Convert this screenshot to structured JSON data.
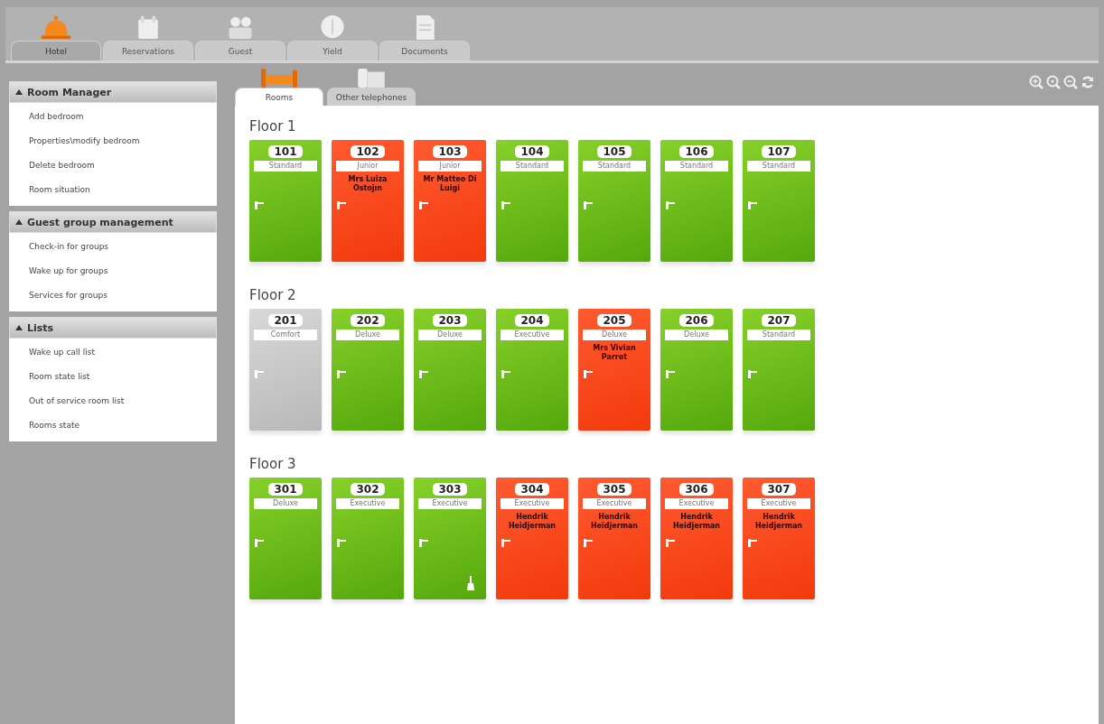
{
  "main_tabs": [
    {
      "label": "Hotel",
      "selected": true
    },
    {
      "label": "Reservations",
      "selected": false
    },
    {
      "label": "Guest",
      "selected": false
    },
    {
      "label": "Yield",
      "selected": false
    },
    {
      "label": "Documents",
      "selected": false
    }
  ],
  "sidebar": {
    "sections": [
      {
        "title": "Room Manager",
        "expanded": true,
        "items": [
          "Add bedroom",
          "Properties\\modify bedroom",
          "Delete bedroom",
          "Room situation"
        ]
      },
      {
        "title": "Guest group management",
        "expanded": true,
        "items": [
          "Check-in for groups",
          "Wake up for groups",
          "Services for groups"
        ]
      },
      {
        "title": "Lists",
        "expanded": true,
        "items": [
          "Wake up call list",
          "Room state list",
          "Out of service room list",
          "Rooms state"
        ]
      }
    ]
  },
  "sub_tabs": [
    {
      "label": "Rooms",
      "selected": true
    },
    {
      "label": "Other telephones",
      "selected": false
    }
  ],
  "floors": [
    {
      "title": "Floor 1",
      "rooms": [
        {
          "number": "101",
          "type": "Standard",
          "kind": "free",
          "cleaning": false
        },
        {
          "number": "102",
          "type": "Junior",
          "kind": "occupied",
          "guest": "Mrs Luiza Ostojın",
          "cleaning": false
        },
        {
          "number": "103",
          "type": "Junior",
          "kind": "occupied",
          "guest": "Mr Matteo Di Luigi",
          "cleaning": false
        },
        {
          "number": "104",
          "type": "Standard",
          "kind": "free",
          "cleaning": false
        },
        {
          "number": "105",
          "type": "Standard",
          "kind": "free",
          "cleaning": false
        },
        {
          "number": "106",
          "type": "Standard",
          "kind": "free",
          "cleaning": false
        },
        {
          "number": "107",
          "type": "Standard",
          "kind": "free",
          "cleaning": false
        }
      ]
    },
    {
      "title": "Floor 2",
      "rooms": [
        {
          "number": "201",
          "type": "Comfort",
          "kind": "out_of_service",
          "cleaning": false
        },
        {
          "number": "202",
          "type": "Deluxe",
          "kind": "free",
          "cleaning": false
        },
        {
          "number": "203",
          "type": "Deluxe",
          "kind": "free",
          "cleaning": false
        },
        {
          "number": "204",
          "type": "Executive",
          "kind": "free",
          "cleaning": false
        },
        {
          "number": "205",
          "type": "Deluxe",
          "kind": "occupied",
          "guest": "Mrs Vivian Parrot",
          "cleaning": false
        },
        {
          "number": "206",
          "type": "Deluxe",
          "kind": "free",
          "cleaning": false
        },
        {
          "number": "207",
          "type": "Standard",
          "kind": "free",
          "cleaning": false
        }
      ]
    },
    {
      "title": "Floor 3",
      "rooms": [
        {
          "number": "301",
          "type": "Deluxe",
          "kind": "free",
          "cleaning": false
        },
        {
          "number": "302",
          "type": "Executive",
          "kind": "free",
          "cleaning": false
        },
        {
          "number": "303",
          "type": "Executive",
          "kind": "free",
          "cleaning": true
        },
        {
          "number": "304",
          "type": "Executive",
          "kind": "occupied",
          "guest": "Hendrik Heidjerman",
          "cleaning": false
        },
        {
          "number": "305",
          "type": "Executive",
          "kind": "occupied",
          "guest": "Hendrik Heidjerman",
          "cleaning": false
        },
        {
          "number": "306",
          "type": "Executive",
          "kind": "occupied",
          "guest": "Hendrik Heidjerman",
          "cleaning": false
        },
        {
          "number": "307",
          "type": "Executive",
          "kind": "occupied",
          "guest": "Hendrik Heidjerman",
          "cleaning": false
        }
      ]
    }
  ]
}
